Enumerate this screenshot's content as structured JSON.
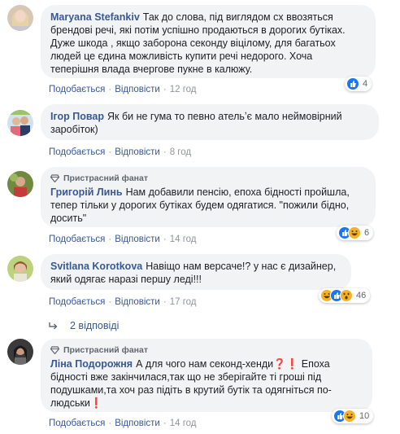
{
  "colors": {
    "author": "#385898",
    "bubble": "#f2f3f5",
    "meta": "#90949c",
    "like": "#1877f2",
    "laugh": "#f7b125"
  },
  "comments": [
    {
      "author": "Maryana Stefankiv",
      "badge": "",
      "lines": [
        "Так до слова, під виглядом сх ввозяться",
        "брендові речі, які потім успішно продаються в дорогих бутіках.",
        "Дуже шкода , якщо заборона секонду віцілому, для багатьох",
        "людей це єдина можливість купити речі недорого. Хоча",
        "теперішня влада вчергове пукне в калюжу."
      ],
      "like": "Подобається",
      "reply": "Відповісти",
      "time": "12 год",
      "reaction_icons": [
        "like"
      ],
      "reaction_count": "4"
    },
    {
      "author": "Ігор Повар",
      "badge": "",
      "lines": [
        "Як би не гума то певно ательʼє мало неймовірний",
        "заробіток)"
      ],
      "like": "Подобається",
      "reply": "Відповісти",
      "time": "8 год",
      "reaction_icons": [],
      "reaction_count": ""
    },
    {
      "author": "Григорій Линь",
      "badge": "Пристрасний фанат",
      "lines": [
        "Нам добавили пенсію, епоха бідності пройшла,",
        "тепер тільки у дорогих бутіках будем одягатися. \"пожили бідно,",
        "досить\""
      ],
      "like": "Подобається",
      "reply": "Відповісти",
      "time": "14 год",
      "reaction_icons": [
        "like",
        "laugh"
      ],
      "reaction_count": "6"
    },
    {
      "author": "Svitlana Korotkova",
      "badge": "",
      "lines": [
        "Навіщо нам версаче!? у нас є дизайнер,",
        "який одягає наразі першу леді!!!"
      ],
      "like": "Подобається",
      "reply": "Відповісти",
      "time": "17 год",
      "reaction_icons": [
        "laugh",
        "like",
        "wow"
      ],
      "reaction_count": "46"
    },
    {
      "author": "Ліна Подорожня",
      "badge": "Пристрасний фанат",
      "lines": [
        "А для чого нам секонд-хенди❓❗ Епоха",
        "бідності вже закінчилася,так що не зберігайте ті гроші під",
        "подушками,та хоч раз підіть в крутий бутік та одягніться по-",
        "людськи❗"
      ],
      "like": "Подобається",
      "reply": "Відповісти",
      "time": "14 год",
      "reaction_icons": [
        "like",
        "laugh"
      ],
      "reaction_count": "10"
    }
  ],
  "replies_link": "2 відповіді"
}
